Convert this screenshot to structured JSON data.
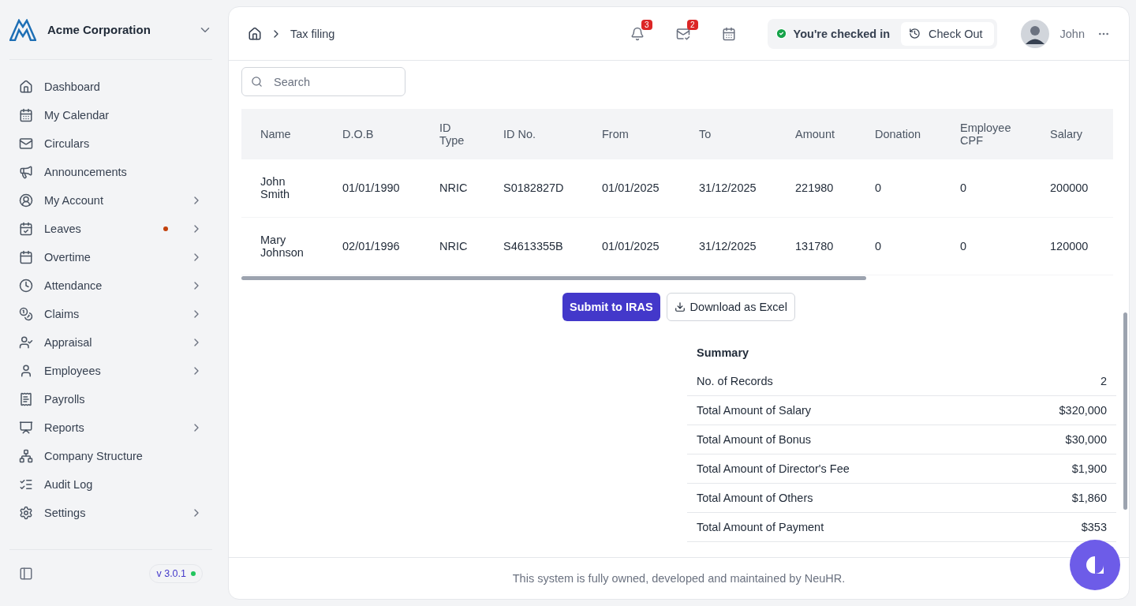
{
  "sidebar": {
    "company": "Acme Corporation",
    "items": [
      {
        "label": "Dashboard",
        "expandable": false,
        "alert": false
      },
      {
        "label": "My Calendar",
        "expandable": false,
        "alert": false
      },
      {
        "label": "Circulars",
        "expandable": false,
        "alert": false
      },
      {
        "label": "Announcements",
        "expandable": false,
        "alert": false
      },
      {
        "label": "My Account",
        "expandable": true,
        "alert": false
      },
      {
        "label": "Leaves",
        "expandable": true,
        "alert": true
      },
      {
        "label": "Overtime",
        "expandable": true,
        "alert": false
      },
      {
        "label": "Attendance",
        "expandable": true,
        "alert": false
      },
      {
        "label": "Claims",
        "expandable": true,
        "alert": false
      },
      {
        "label": "Appraisal",
        "expandable": true,
        "alert": false
      },
      {
        "label": "Employees",
        "expandable": true,
        "alert": false
      },
      {
        "label": "Payrolls",
        "expandable": false,
        "alert": false
      },
      {
        "label": "Reports",
        "expandable": true,
        "alert": false
      },
      {
        "label": "Company Structure",
        "expandable": false,
        "alert": false
      },
      {
        "label": "Audit Log",
        "expandable": false,
        "alert": false
      },
      {
        "label": "Settings",
        "expandable": true,
        "alert": false
      }
    ],
    "version": "v 3.0.1"
  },
  "header": {
    "breadcrumb": "Tax filing",
    "notifications": "3",
    "tasks": "2",
    "check_status": "You're checked in",
    "check_out": "Check Out",
    "user": "John"
  },
  "search": {
    "placeholder": "Search"
  },
  "table": {
    "columns": [
      "Name",
      "D.O.B",
      "ID Type",
      "ID No.",
      "From",
      "To",
      "Amount",
      "Donation",
      "Employee CPF",
      "Salary"
    ],
    "rows": [
      [
        "John Smith",
        "01/01/1990",
        "NRIC",
        "S0182827D",
        "01/01/2025",
        "31/12/2025",
        "221980",
        "0",
        "0",
        "200000"
      ],
      [
        "Mary Johnson",
        "02/01/1996",
        "NRIC",
        "S4613355B",
        "01/01/2025",
        "31/12/2025",
        "131780",
        "0",
        "0",
        "120000"
      ]
    ]
  },
  "actions": {
    "submit": "Submit to IRAS",
    "download": "Download as Excel"
  },
  "summary": {
    "title": "Summary",
    "rows": [
      {
        "label": "No. of Records",
        "value": "2"
      },
      {
        "label": "Total Amount of Salary",
        "value": "$320,000"
      },
      {
        "label": "Total Amount of Bonus",
        "value": "$30,000"
      },
      {
        "label": "Total Amount of Director's Fee",
        "value": "$1,900"
      },
      {
        "label": "Total Amount of Others",
        "value": "$1,860"
      },
      {
        "label": "Total Amount of Payment",
        "value": "$353"
      }
    ]
  },
  "footer": "This system is fully owned, developed and maintained by NeuHR."
}
